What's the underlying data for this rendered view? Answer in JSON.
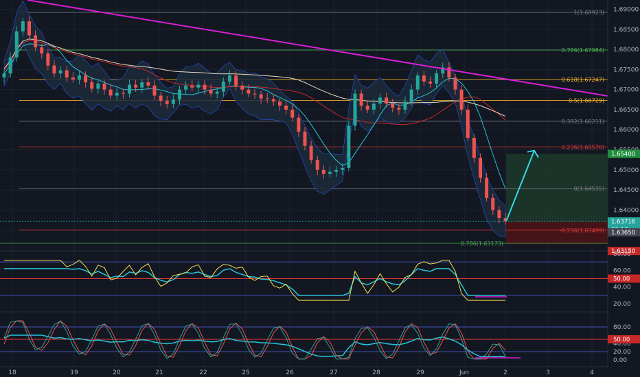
{
  "colors": {
    "background": "#131722",
    "bull": "#26a69a",
    "bear": "#ef5350",
    "trendline": "#d81fd8",
    "arrow": "#38d6e6",
    "target_zone": "#1c3a2a",
    "stop_zone": "#4a1418",
    "rsi_line": "#f4e04d",
    "ma_cyan": "#26c6da",
    "band_fill": "#1c2a3a",
    "fib_green": "#4caf50",
    "fib_red": "#e53935",
    "fib_orange": "#f0b429",
    "fib_gray": "#787b86"
  },
  "price_axis": {
    "ticks": [
      "1.69000",
      "1.68500",
      "1.68000",
      "1.67500",
      "1.67000",
      "1.66500",
      "1.66000",
      "1.65500",
      "1.65000",
      "1.64500",
      "1.64000",
      "1.63500"
    ],
    "ylim": [
      1.6315,
      1.691
    ],
    "target_tag": "1.65400",
    "current_tag": "1.63716",
    "countdown_tag": "39:18",
    "entry_tag": "1.63650",
    "stop_tag": "1.63150"
  },
  "fib_levels": [
    {
      "label": "1(1.68923)",
      "price": 1.68923,
      "color": "gray"
    },
    {
      "label": "0.786(1.67984)",
      "price": 1.67984,
      "color": "green"
    },
    {
      "label": "0.618(1.67247)",
      "price": 1.67247,
      "color": "orange"
    },
    {
      "label": "0.5(1.66729)",
      "price": 1.66729,
      "color": "orange"
    },
    {
      "label": "0.382(1.66211)",
      "price": 1.66211,
      "color": "gray"
    },
    {
      "label": "0.236(1.65570)",
      "price": 1.6557,
      "color": "red"
    },
    {
      "label": "0(1.64535)",
      "price": 1.64535,
      "color": "gray"
    },
    {
      "label": "-0.236(1.63499)",
      "price": 1.63499,
      "color": "red"
    },
    {
      "label": "0.786(1.63173)",
      "price": 1.63173,
      "color": "green"
    }
  ],
  "rsi_panel": {
    "ticks": [
      "80.00",
      "60.00",
      "40.00",
      "20.00"
    ],
    "level_tag": "50.00"
  },
  "stoch_panel": {
    "ticks": [
      "80.00",
      "40.00",
      "20.00",
      "0.00"
    ],
    "level_tag": "50.00"
  },
  "time_axis": [
    "18",
    "19",
    "20",
    "21",
    "22",
    "25",
    "26",
    "27",
    "28",
    "29",
    "Jun",
    "2",
    "3",
    "4"
  ],
  "chart_data": {
    "type": "candlestick",
    "close_series": [
      1.674,
      1.678,
      1.6845,
      1.687,
      1.6835,
      1.6805,
      1.679,
      1.676,
      1.674,
      1.6748,
      1.673,
      1.6725,
      1.6735,
      1.6718,
      1.6702,
      1.6715,
      1.67,
      1.6685,
      1.6692,
      1.669,
      1.6712,
      1.6705,
      1.6718,
      1.671,
      1.6685,
      1.6672,
      1.6664,
      1.6675,
      1.67,
      1.671,
      1.6705,
      1.6712,
      1.67,
      1.669,
      1.6695,
      1.672,
      1.6735,
      1.671,
      1.67,
      1.669,
      1.6688,
      1.6678,
      1.6676,
      1.667,
      1.666,
      1.665,
      1.663,
      1.6595,
      1.656,
      1.6525,
      1.65,
      1.649,
      1.6495,
      1.65,
      1.6505,
      1.661,
      1.669,
      1.666,
      1.665,
      1.6665,
      1.668,
      1.6665,
      1.6655,
      1.665,
      1.667,
      1.67,
      1.6735,
      1.672,
      1.6715,
      1.674,
      1.6755,
      1.673,
      1.67,
      1.665,
      1.658,
      1.653,
      1.648,
      1.643,
      1.64,
      1.638,
      1.6372
    ]
  }
}
